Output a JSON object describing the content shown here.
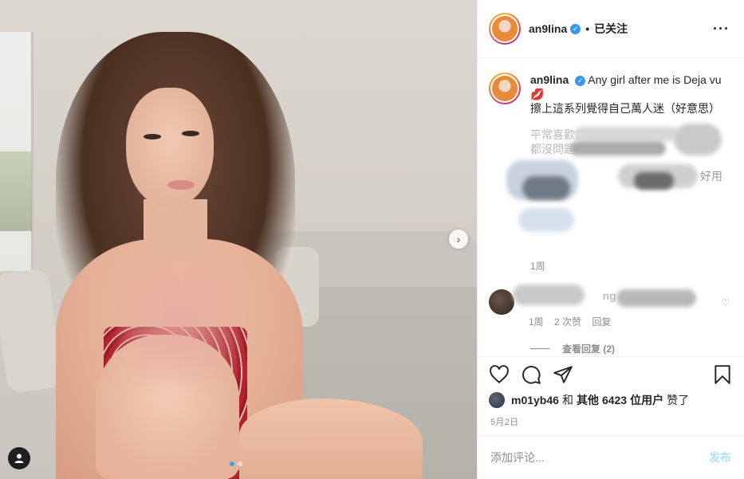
{
  "post": {
    "username": "an9lina",
    "follow_status": "已关注",
    "more": "···",
    "separator": "•"
  },
  "caption": {
    "username": "an9lina",
    "line1": "Any girl after me is Deja vu",
    "emoji": "💋",
    "line2": "擦上這系列覺得自己萬人迷（好意思）",
    "line3": "平常喜歡的",
    "line3_tail": "到",
    "line4": "都沒問題",
    "line5_tail": "好用",
    "time": "1周"
  },
  "reply": {
    "username": "chan",
    "username_tail": "ng",
    "meta_time": "1周",
    "meta_likes": "2 次赞",
    "meta_reply": "回复",
    "view_replies": "查看回复 (2)"
  },
  "likes": {
    "user": "m01yb46",
    "and": "和",
    "others_prefix": "其他",
    "count": "6423",
    "others_suffix": "位用户",
    "liked": "赞了"
  },
  "date": "5月2日",
  "comment_box": {
    "placeholder": "添加评论...",
    "post_label": "发布"
  },
  "icons": {
    "verified": "verified-badge-icon",
    "heart": "heart-icon",
    "comment": "comment-icon",
    "share": "share-icon",
    "save": "bookmark-icon",
    "next": "chevron-right-icon",
    "user_tag": "user-tag-icon"
  },
  "colors": {
    "verified": "#3897f0",
    "post_button_disabled": "#b2dffc",
    "meta_text": "#8e8e8e"
  }
}
